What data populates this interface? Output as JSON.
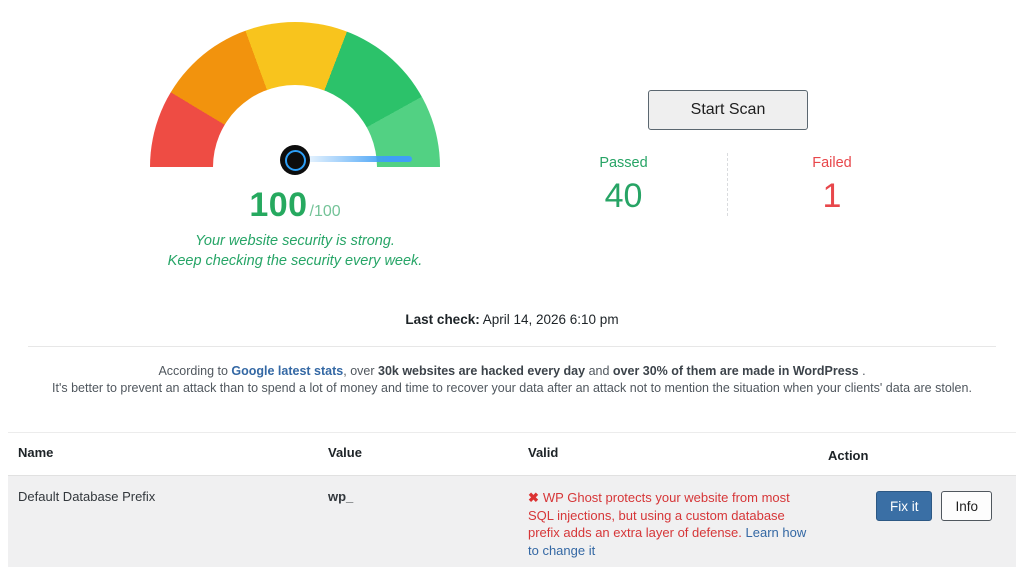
{
  "gauge": {
    "score": "100",
    "score_max": "/100",
    "subtitle_line1": "Your website security is strong.",
    "subtitle_line2": "Keep checking the security every week.",
    "colors": {
      "red": "#ee4c44",
      "orange": "#f2930d",
      "yellow": "#f8c41d",
      "green": "#2cc26a",
      "light_green": "#52d183",
      "needle_blue": "#3f9ff6",
      "score_green": "#26a95f"
    }
  },
  "scan": {
    "button_label": "Start Scan",
    "passed_label": "Passed",
    "passed_value": "40",
    "failed_label": "Failed",
    "failed_value": "1",
    "passed_color": "#27a465",
    "failed_color": "#e8474b"
  },
  "last_check": {
    "label": "Last check:",
    "value": " April 14, 2026 6:10 pm"
  },
  "stats_note": {
    "line1_prefix": "According to ",
    "line1_link": "Google latest stats",
    "line1_mid1": ", over ",
    "line1_bold1": "30k websites are hacked every day",
    "line1_mid2": " and ",
    "line1_bold2": "over 30% of them are made in WordPress",
    "line1_suffix": " .",
    "line2": "It's better to prevent an attack than to spend a lot of money and time to recover your data after an attack not to mention the situation when your clients' data are stolen."
  },
  "table": {
    "headers": [
      "Name",
      "Value",
      "Valid",
      "Action"
    ],
    "row": {
      "name": "Default Database Prefix",
      "value": "wp_",
      "valid_icon": "✖",
      "valid_text": "WP Ghost protects your website from most SQL injections, but using a custom database prefix adds an extra layer of defense. ",
      "valid_link": "Learn how to change it",
      "fix_label": "Fix it",
      "info_label": "Info"
    }
  }
}
